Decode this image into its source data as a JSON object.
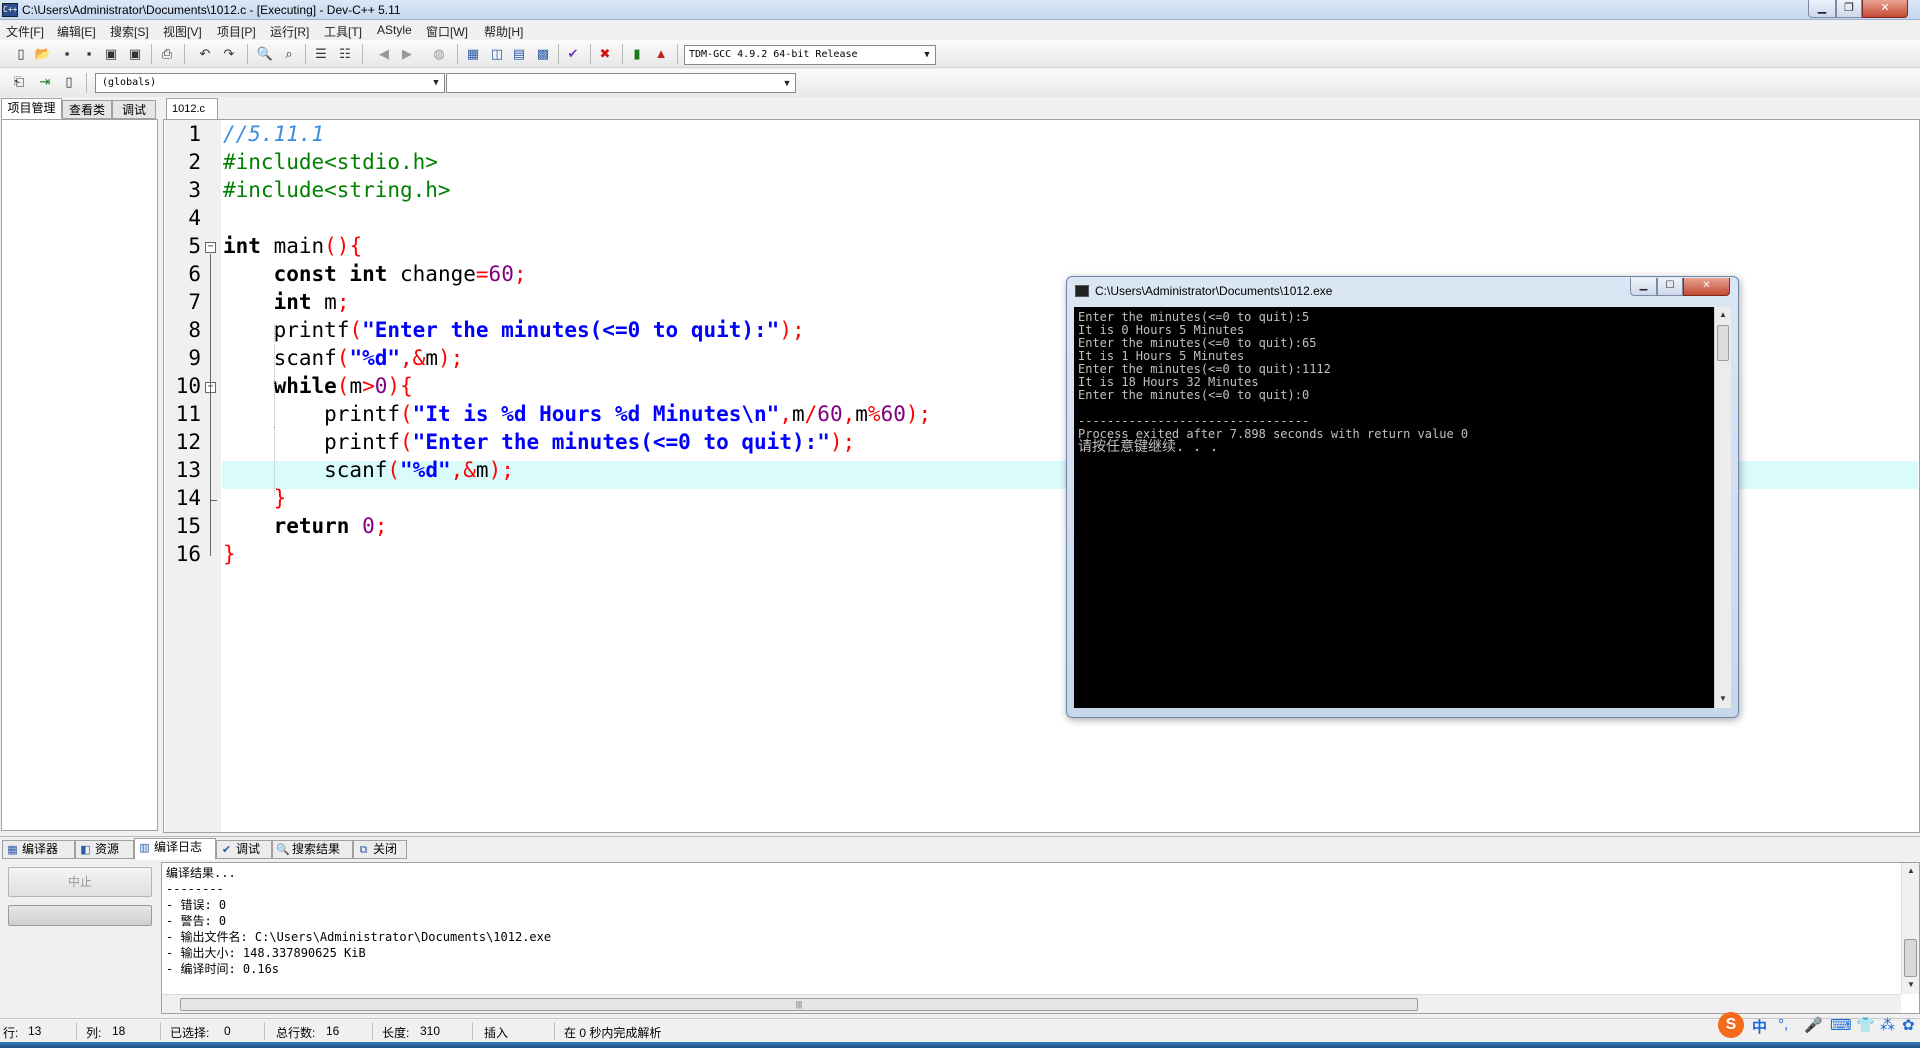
{
  "window": {
    "title": "C:\\Users\\Administrator\\Documents\\1012.c - [Executing] - Dev-C++ 5.11",
    "app_icon_text": "C++"
  },
  "menu": [
    "文件[F]",
    "编辑[E]",
    "搜索[S]",
    "视图[V]",
    "项目[P]",
    "运行[R]",
    "工具[T]",
    "AStyle",
    "窗口[W]",
    "帮助[H]"
  ],
  "toolbar": {
    "compiler_select": "TDM-GCC 4.9.2 64-bit Release",
    "globals_select": "(globals)"
  },
  "left_panel": {
    "tabs": [
      "项目管理",
      "查看类",
      "调试"
    ]
  },
  "editor": {
    "tab": "1012.c",
    "line_numbers": [
      "1",
      "2",
      "3",
      "4",
      "5",
      "6",
      "7",
      "8",
      "9",
      "10",
      "11",
      "12",
      "13",
      "14",
      "15",
      "16"
    ],
    "current_line": 13,
    "lines": [
      [
        {
          "t": "//5.11.1",
          "c": "comment"
        }
      ],
      [
        {
          "t": "#include<stdio.h>",
          "c": "pre"
        }
      ],
      [
        {
          "t": "#include<string.h>",
          "c": "pre"
        }
      ],
      [],
      [
        {
          "t": "int",
          "c": "kw"
        },
        {
          "t": " main",
          "c": "plain"
        },
        {
          "t": "(){",
          "c": "sym"
        }
      ],
      [
        {
          "t": "    ",
          "c": "plain"
        },
        {
          "t": "const int",
          "c": "kw"
        },
        {
          "t": " change",
          "c": "plain"
        },
        {
          "t": "=",
          "c": "sym"
        },
        {
          "t": "60",
          "c": "num"
        },
        {
          "t": ";",
          "c": "sym"
        }
      ],
      [
        {
          "t": "    ",
          "c": "plain"
        },
        {
          "t": "int",
          "c": "kw"
        },
        {
          "t": " m",
          "c": "plain"
        },
        {
          "t": ";",
          "c": "sym"
        }
      ],
      [
        {
          "t": "    printf",
          "c": "plain"
        },
        {
          "t": "(",
          "c": "sym"
        },
        {
          "t": "\"Enter the minutes(<=0 to quit):\"",
          "c": "str"
        },
        {
          "t": ");",
          "c": "sym"
        }
      ],
      [
        {
          "t": "    scanf",
          "c": "plain"
        },
        {
          "t": "(",
          "c": "sym"
        },
        {
          "t": "\"%d\"",
          "c": "str"
        },
        {
          "t": ",&",
          "c": "sym"
        },
        {
          "t": "m",
          "c": "plain"
        },
        {
          "t": ");",
          "c": "sym"
        }
      ],
      [
        {
          "t": "    ",
          "c": "plain"
        },
        {
          "t": "while",
          "c": "kw"
        },
        {
          "t": "(",
          "c": "sym"
        },
        {
          "t": "m",
          "c": "plain"
        },
        {
          "t": ">",
          "c": "sym"
        },
        {
          "t": "0",
          "c": "num"
        },
        {
          "t": "){",
          "c": "sym"
        }
      ],
      [
        {
          "t": "        printf",
          "c": "plain"
        },
        {
          "t": "(",
          "c": "sym"
        },
        {
          "t": "\"It is %d Hours %d Minutes\\n\"",
          "c": "str"
        },
        {
          "t": ",",
          "c": "sym"
        },
        {
          "t": "m",
          "c": "plain"
        },
        {
          "t": "/",
          "c": "sym"
        },
        {
          "t": "60",
          "c": "num"
        },
        {
          "t": ",",
          "c": "sym"
        },
        {
          "t": "m",
          "c": "plain"
        },
        {
          "t": "%",
          "c": "sym"
        },
        {
          "t": "60",
          "c": "num"
        },
        {
          "t": ");",
          "c": "sym"
        }
      ],
      [
        {
          "t": "        printf",
          "c": "plain"
        },
        {
          "t": "(",
          "c": "sym"
        },
        {
          "t": "\"Enter the minutes(<=0 to quit):\"",
          "c": "str"
        },
        {
          "t": ");",
          "c": "sym"
        }
      ],
      [
        {
          "t": "        scanf",
          "c": "plain"
        },
        {
          "t": "(",
          "c": "sym"
        },
        {
          "t": "\"%d\"",
          "c": "str"
        },
        {
          "t": ",&",
          "c": "sym"
        },
        {
          "t": "m",
          "c": "plain"
        },
        {
          "t": ");",
          "c": "sym"
        }
      ],
      [
        {
          "t": "    ",
          "c": "plain"
        },
        {
          "t": "}",
          "c": "sym"
        }
      ],
      [
        {
          "t": "    ",
          "c": "plain"
        },
        {
          "t": "return",
          "c": "kw"
        },
        {
          "t": " ",
          "c": "plain"
        },
        {
          "t": "0",
          "c": "num"
        },
        {
          "t": ";",
          "c": "sym"
        }
      ],
      [
        {
          "t": "}",
          "c": "sym"
        }
      ]
    ]
  },
  "console": {
    "title": "C:\\Users\\Administrator\\Documents\\1012.exe",
    "lines": [
      "Enter the minutes(<=0 to quit):5",
      "It is 0 Hours 5 Minutes",
      "Enter the minutes(<=0 to quit):65",
      "It is 1 Hours 5 Minutes",
      "Enter the minutes(<=0 to quit):1112",
      "It is 18 Hours 32 Minutes",
      "Enter the minutes(<=0 to quit):0",
      "",
      "--------------------------------",
      "Process exited after 7.898 seconds with return value 0",
      "请按任意键继续. . ."
    ]
  },
  "bottom_tabs": [
    {
      "label": "编译器",
      "icon": "▦"
    },
    {
      "label": "资源",
      "icon": "◧"
    },
    {
      "label": "编译日志",
      "icon": "▥"
    },
    {
      "label": "调试",
      "icon": "✔"
    },
    {
      "label": "搜索结果",
      "icon": "🔍"
    },
    {
      "label": "关闭",
      "icon": "⧉"
    }
  ],
  "bottom_active_tab": 2,
  "abort_button": "中止",
  "compile_log": [
    "编译结果...",
    "--------",
    "- 错误: 0",
    "- 警告: 0",
    "- 输出文件名: C:\\Users\\Administrator\\Documents\\1012.exe",
    "- 输出大小: 148.337890625 KiB",
    "- 编译时间: 0.16s"
  ],
  "statusbar": {
    "row_label": "行:",
    "row": "13",
    "col_label": "列:",
    "col": "18",
    "sel_label": "已选择:",
    "sel": "0",
    "total_label": "总行数:",
    "total": "16",
    "len_label": "长度:",
    "len": "310",
    "mode": "插入",
    "parse": "在 0 秒内完成解析"
  },
  "ime": {
    "logo": "S",
    "lang": "中"
  }
}
